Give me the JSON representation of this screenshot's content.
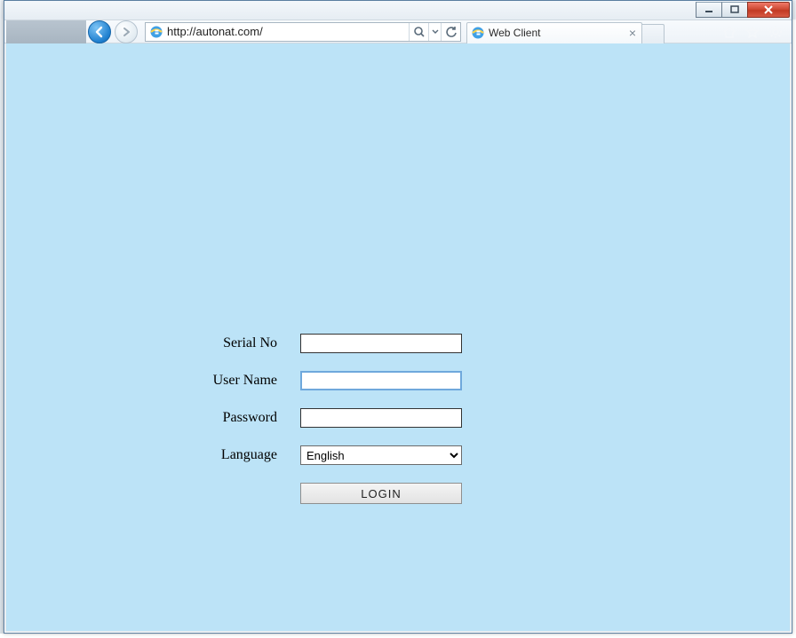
{
  "browser": {
    "url": "http://autonat.com/",
    "tab_title": "Web Client"
  },
  "form": {
    "labels": {
      "serial": "Serial No",
      "username": "User Name",
      "password": "Password",
      "language": "Language"
    },
    "values": {
      "serial": "",
      "username": "",
      "password": "",
      "language": "English"
    },
    "login_button": "LOGIN"
  }
}
